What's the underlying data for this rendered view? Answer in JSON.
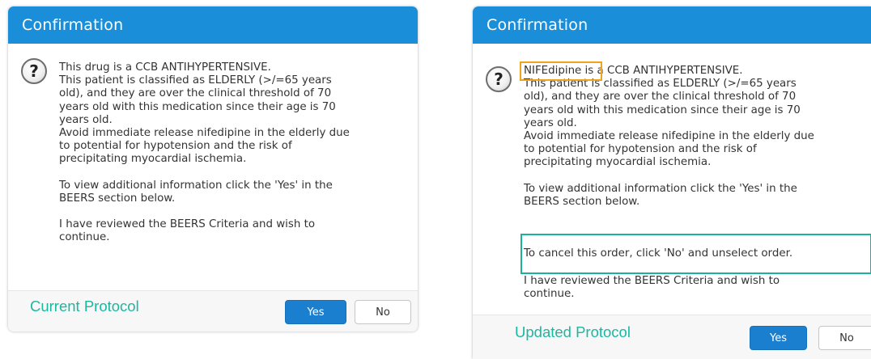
{
  "dialog_current": {
    "title": "Confirmation",
    "message_lines": [
      "This drug is a CCB ANTIHYPERTENSIVE.",
      "This patient is classified as ELDERLY (>/=65 years",
      "old), and they are over the clinical threshold of 70",
      "years old with this medication since their age is 70",
      "years old.",
      "Avoid immediate release nifedipine in the elderly due",
      "to potential for hypotension and the risk of",
      "precipitating myocardial ischemia.",
      "",
      "To view additional information click the 'Yes' in the",
      "BEERS section below.",
      "",
      "I have reviewed the BEERS Criteria and wish to",
      "continue."
    ],
    "protocol_label": "Current Protocol",
    "yes_label": "Yes",
    "no_label": "No"
  },
  "dialog_updated": {
    "title": "Confirmation",
    "drug_name": "NIFEdipine",
    "first_line_rest": " is a CCB ANTIHYPERTENSIVE.",
    "message_lines": [
      "This patient is classified as ELDERLY (>/=65 years",
      "old), and they are over the clinical threshold of 70",
      "years old with this medication since their age is 70",
      "years old.",
      "Avoid immediate release nifedipine in the elderly due",
      "to potential for hypotension and the risk of",
      "precipitating myocardial ischemia.",
      "",
      "To view additional information click the 'Yes' in the",
      "BEERS section below."
    ],
    "cancel_instruction": "To cancel this order, click 'No' and unselect order.",
    "review_lines": [
      "I have reviewed the BEERS Criteria and wish to",
      "continue."
    ],
    "protocol_label": "Updated Protocol",
    "yes_label": "Yes",
    "no_label": "No"
  },
  "colors": {
    "title_bar": "#1a8ed8",
    "primary_button": "#1b7fd0",
    "protocol_label": "#1bb8a0",
    "highlight_drug_name": "#f0a320",
    "highlight_cancel_line": "#19b39b"
  },
  "icons": {
    "dialog_icon": "question-circle-icon"
  }
}
